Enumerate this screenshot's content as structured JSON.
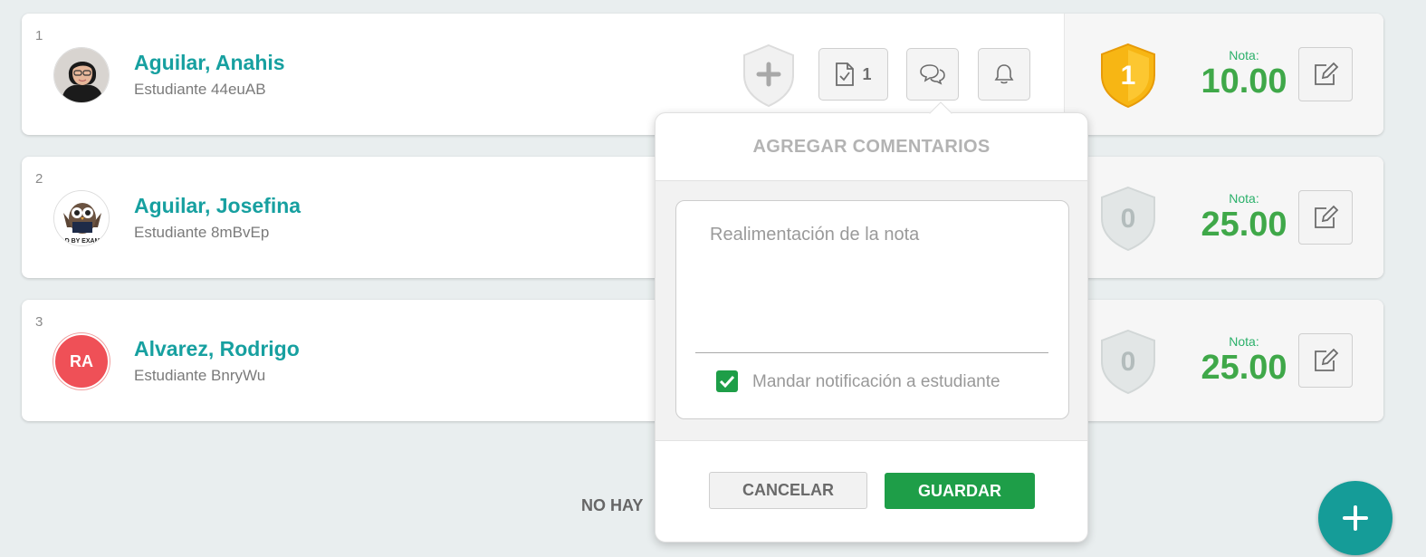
{
  "students": [
    {
      "index": "1",
      "name": "Aguilar, Anahis",
      "id_label": "Estudiante 44euAB",
      "badge_value": "1",
      "badge_type": "gold",
      "nota_label": "Nota:",
      "nota_value": "10.00"
    },
    {
      "index": "2",
      "name": "Aguilar, Josefina",
      "id_label": "Estudiante 8mBvEp",
      "badge_value": "0",
      "badge_type": "gray",
      "nota_label": "Nota:",
      "nota_value": "25.00"
    },
    {
      "index": "3",
      "name": "Alvarez, Rodrigo",
      "id_label": "Estudiante BnryWu",
      "avatar_initials": "RA",
      "badge_value": "0",
      "badge_type": "gray",
      "nota_label": "Nota:",
      "nota_value": "25.00"
    }
  ],
  "row1_actions": {
    "tasks_count": "1"
  },
  "comment_popover": {
    "title": "AGREGAR COMENTARIOS",
    "placeholder": "Realimentación de la nota",
    "notify_label": "Mandar notificación a estudiante",
    "notify_checked": true,
    "cancel_label": "CANCELAR",
    "save_label": "GUARDAR"
  },
  "footer_text": "NO HAY",
  "colors": {
    "teal": "#17a0a0",
    "green": "#3fa849",
    "save_green": "#1e9e48",
    "gold": "#f7b614",
    "fab": "#159c98"
  }
}
